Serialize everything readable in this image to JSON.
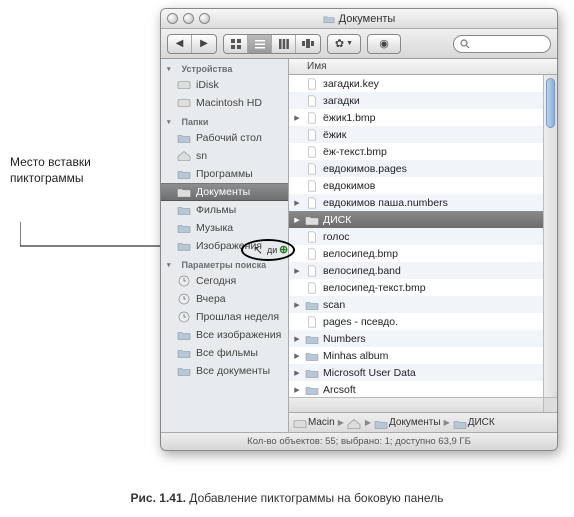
{
  "annotation": {
    "line1": "Место вставки",
    "line2": "пиктограммы"
  },
  "caption_prefix": "Рис. 1.41.",
  "caption_text": " Добавление пиктограммы на боковую панель",
  "window": {
    "title": "Документы"
  },
  "toolbar": {
    "search_placeholder": ""
  },
  "sidebar": {
    "sections": [
      {
        "title": "Устройства",
        "items": [
          {
            "icon": "idisk",
            "label": "iDisk"
          },
          {
            "icon": "hd",
            "label": "Macintosh HD"
          }
        ]
      },
      {
        "title": "Папки",
        "items": [
          {
            "icon": "desktop",
            "label": "Рабочий стол"
          },
          {
            "icon": "home",
            "label": "sn"
          },
          {
            "icon": "apps",
            "label": "Программы"
          },
          {
            "icon": "docs",
            "label": "Документы",
            "selected": true
          },
          {
            "icon": "movies",
            "label": "Фильмы"
          },
          {
            "icon": "music",
            "label": "Музыка"
          },
          {
            "icon": "pictures",
            "label": "Изображения"
          }
        ]
      },
      {
        "title": "Параметры поиска",
        "items": [
          {
            "icon": "clock",
            "label": "Сегодня"
          },
          {
            "icon": "clock",
            "label": "Вчера"
          },
          {
            "icon": "clock",
            "label": "Прошлая неделя"
          },
          {
            "icon": "smart",
            "label": "Все изображения"
          },
          {
            "icon": "smart",
            "label": "Все фильмы"
          },
          {
            "icon": "smart",
            "label": "Все документы"
          }
        ]
      }
    ]
  },
  "content": {
    "column_header": "Имя",
    "rows": [
      {
        "expand": "",
        "icon": "key",
        "name": "загадки.key"
      },
      {
        "expand": "",
        "icon": "doc",
        "name": "загадки"
      },
      {
        "expand": "▶",
        "icon": "doc",
        "name": "ёжик1.bmp"
      },
      {
        "expand": "",
        "icon": "doc",
        "name": "ёжик"
      },
      {
        "expand": "",
        "icon": "doc",
        "name": "ёж-текст.bmp"
      },
      {
        "expand": "",
        "icon": "pages",
        "name": "евдокимов.pages"
      },
      {
        "expand": "",
        "icon": "doc",
        "name": "евдокимов"
      },
      {
        "expand": "▶",
        "icon": "num",
        "name": "евдокимов паша.numbers"
      },
      {
        "expand": "▶",
        "icon": "folder",
        "name": "ДИСК",
        "selected": true
      },
      {
        "expand": "",
        "icon": "doc",
        "name": "голос"
      },
      {
        "expand": "",
        "icon": "doc",
        "name": "велосипед.bmp"
      },
      {
        "expand": "▶",
        "icon": "band",
        "name": "велосипед.band"
      },
      {
        "expand": "",
        "icon": "doc",
        "name": "велосипед-текст.bmp"
      },
      {
        "expand": "▶",
        "icon": "folder",
        "name": "scan"
      },
      {
        "expand": "",
        "icon": "doc",
        "name": "pages - псевдо."
      },
      {
        "expand": "▶",
        "icon": "folder",
        "name": "Numbers"
      },
      {
        "expand": "▶",
        "icon": "folder",
        "name": "Minhas album"
      },
      {
        "expand": "▶",
        "icon": "folder",
        "name": "Microsoft User Data"
      },
      {
        "expand": "▶",
        "icon": "folder",
        "name": "Arcsoft"
      }
    ]
  },
  "pathbar": [
    {
      "icon": "hd",
      "label": "Macin"
    },
    {
      "icon": "home",
      "label": ""
    },
    {
      "icon": "docs",
      "label": "Документы"
    },
    {
      "icon": "folder",
      "label": "ДИСК"
    }
  ],
  "statusbar": "Кол-во объектов: 55; выбрано: 1; доступно 63,9 ГБ",
  "drag_label": "ди"
}
